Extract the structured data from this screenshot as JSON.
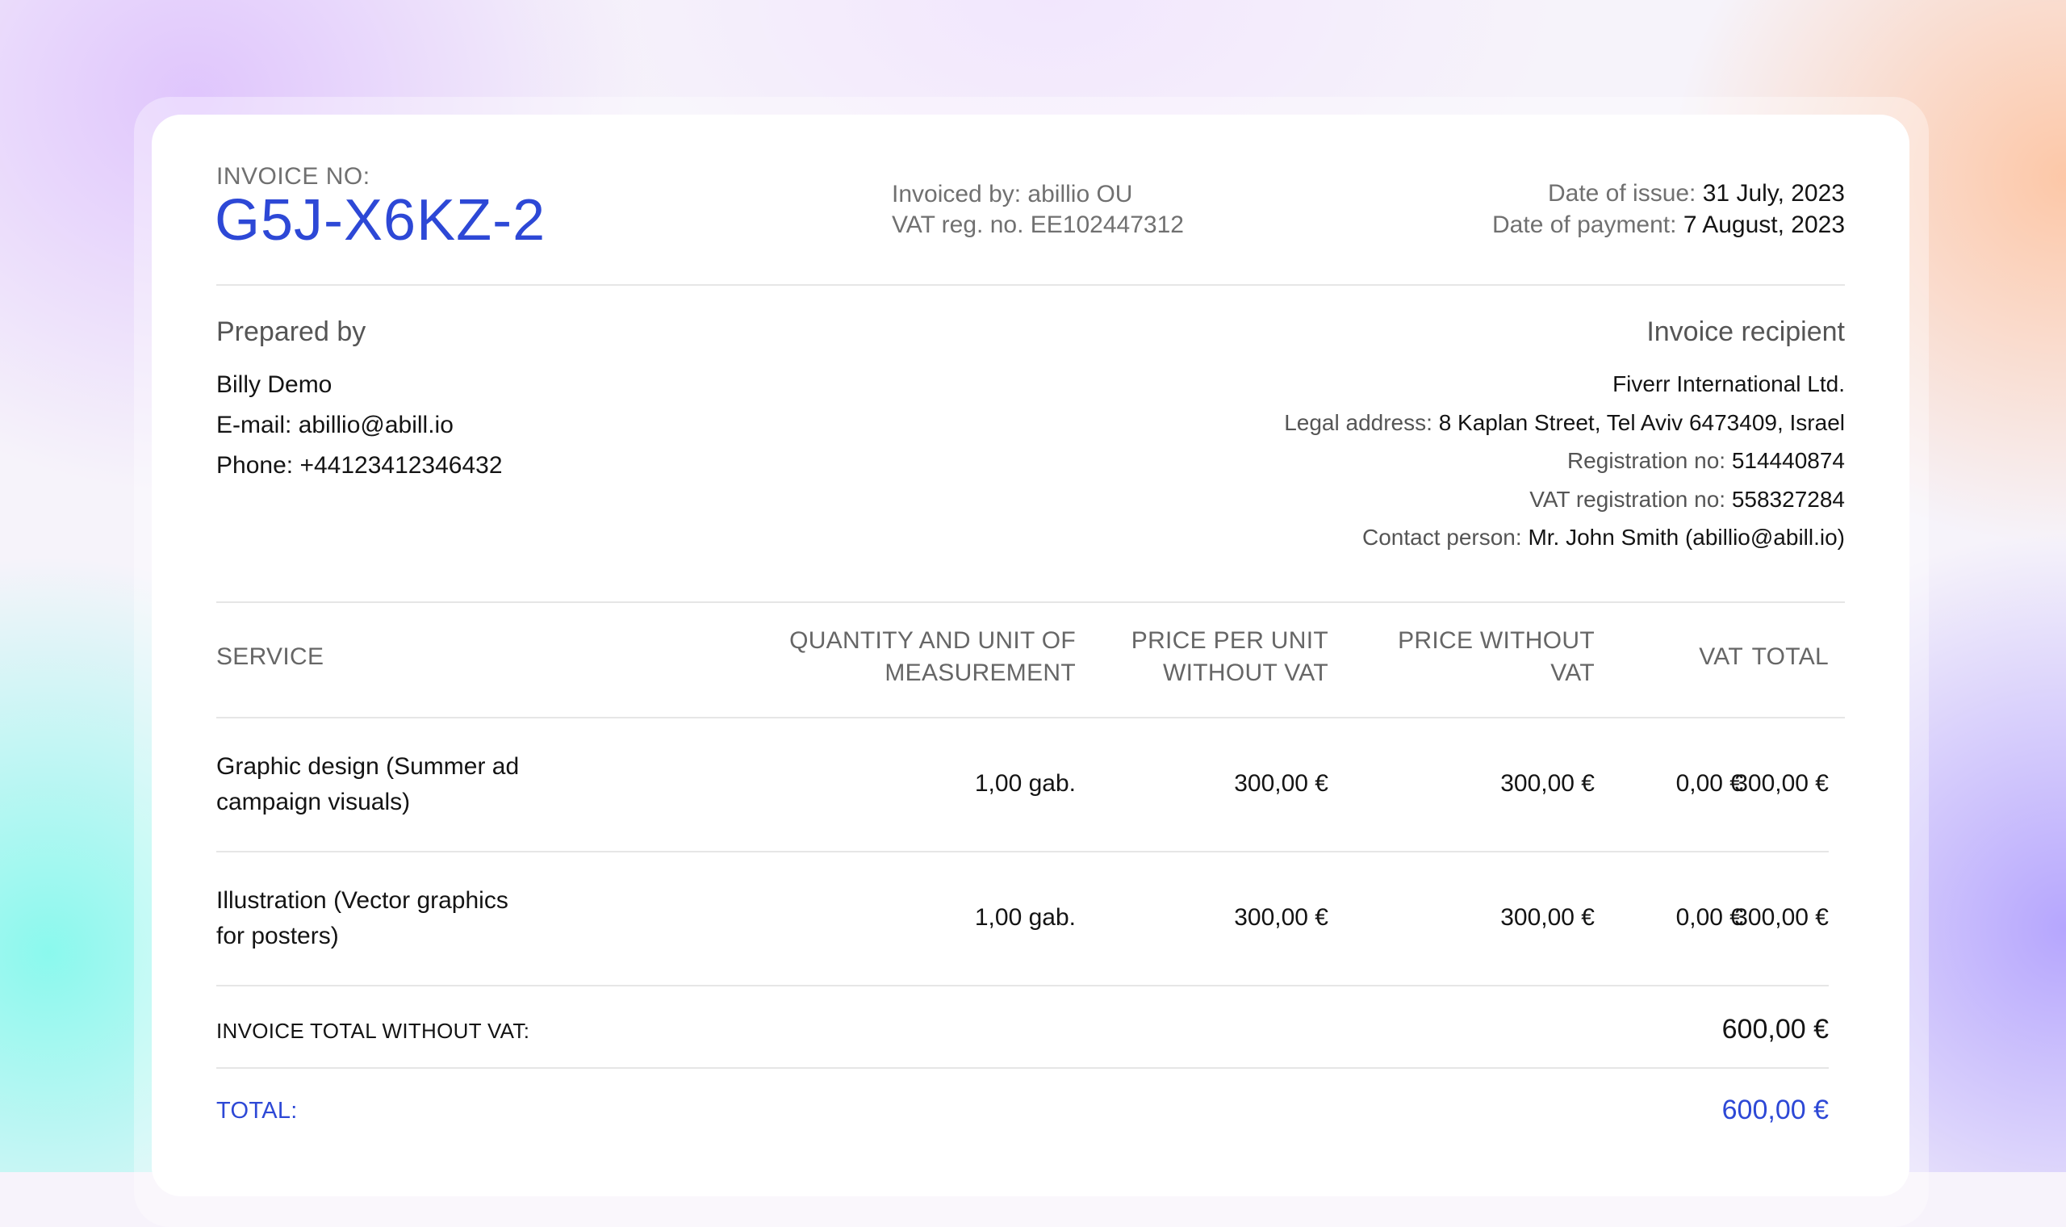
{
  "invoice": {
    "label": "INVOICE NO:",
    "number": "G5J-X6KZ-2",
    "invoiced_by": "Invoiced by: abillio OU",
    "vat_reg": "VAT reg. no. EE102447312",
    "date_issue_label": "Date of issue:",
    "date_issue": "31 July, 2023",
    "date_payment_label": "Date of payment:",
    "date_payment": "7 August, 2023"
  },
  "prepared": {
    "title": "Prepared by",
    "name": "Billy Demo",
    "email_label": "E-mail:",
    "email": "abillio@abill.io",
    "phone_label": "Phone:",
    "phone": "+44123412346432"
  },
  "recipient": {
    "title": "Invoice recipient",
    "company": "Fiverr International Ltd.",
    "address_label": "Legal address:",
    "address": "8 Kaplan Street, Tel Aviv 6473409, Israel",
    "reg_label": "Registration no:",
    "reg": "514440874",
    "vat_label": "VAT registration no:",
    "vat": "558327284",
    "contact_label": "Contact person:",
    "contact": "Mr. John Smith (abillio@abill.io)"
  },
  "table": {
    "headers": {
      "service": "SERVICE",
      "qty_1": "QUANTITY AND UNIT OF",
      "qty_2": "MEASUREMENT",
      "ppu_1": "PRICE PER UNIT",
      "ppu_2": "WITHOUT VAT",
      "pwv_1": "PRICE WITHOUT",
      "pwv_2": "VAT",
      "vat": "VAT",
      "total": "TOTAL"
    },
    "rows": [
      {
        "service_1": "Graphic design (Summer ad",
        "service_2": "campaign visuals)",
        "qty": "1,00 gab.",
        "ppu": "300,00 €",
        "pwv": "300,00 €",
        "vat": "0,00 €",
        "total": "300,00 €"
      },
      {
        "service_1": "Illustration (Vector graphics",
        "service_2": "for posters)",
        "qty": "1,00 gab.",
        "ppu": "300,00 €",
        "pwv": "300,00 €",
        "vat": "0,00 €",
        "total": "300,00 €"
      }
    ]
  },
  "summary": {
    "subtotal_label": "INVOICE TOTAL WITHOUT VAT:",
    "subtotal": "600,00 €",
    "total_label": "TOTAL:",
    "total": "600,00 €"
  }
}
